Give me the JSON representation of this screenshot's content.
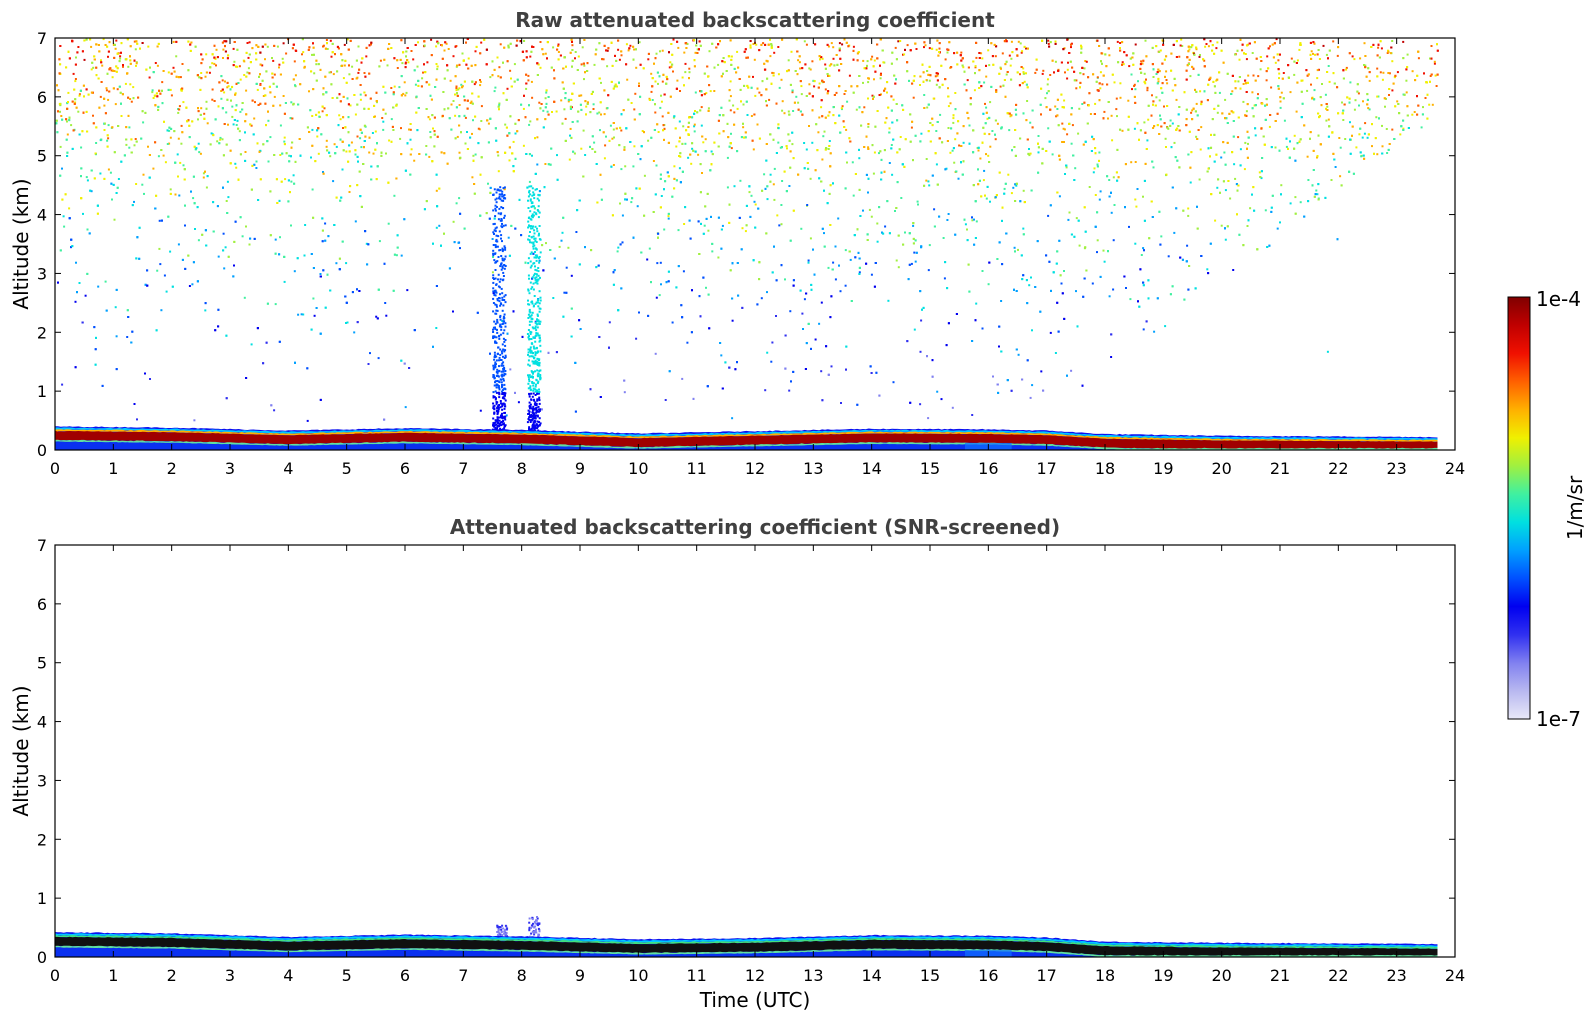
{
  "chart_data": [
    {
      "type": "heatmap",
      "title": "Raw attenuated backscattering coefficient",
      "xlabel": "",
      "ylabel": "Altitude (km)",
      "xlim": [
        0,
        24
      ],
      "ylim": [
        0,
        7
      ],
      "xticks": [
        "0",
        "1",
        "2",
        "3",
        "4",
        "5",
        "6",
        "7",
        "8",
        "9",
        "10",
        "11",
        "12",
        "13",
        "14",
        "15",
        "16",
        "17",
        "18",
        "19",
        "20",
        "21",
        "22",
        "23",
        "24"
      ],
      "yticks": [
        "0",
        "1",
        "2",
        "3",
        "4",
        "5",
        "6",
        "7"
      ],
      "grid": false,
      "data_end_time": 23.7,
      "layer_top_km": [
        {
          "t": 0,
          "km": 0.4
        },
        {
          "t": 2,
          "km": 0.38
        },
        {
          "t": 4,
          "km": 0.33
        },
        {
          "t": 6,
          "km": 0.37
        },
        {
          "t": 8,
          "km": 0.34
        },
        {
          "t": 10,
          "km": 0.28
        },
        {
          "t": 12,
          "km": 0.32
        },
        {
          "t": 14,
          "km": 0.36
        },
        {
          "t": 16,
          "km": 0.35
        },
        {
          "t": 17,
          "km": 0.33
        },
        {
          "t": 18,
          "km": 0.27
        },
        {
          "t": 20,
          "km": 0.24
        },
        {
          "t": 22,
          "km": 0.23
        },
        {
          "t": 23.7,
          "km": 0.22
        }
      ],
      "high_signal_noise_top": "above ~5 km across the day, extending down toward the surface before ~17 UTC",
      "vertical_features_time": [
        7.6,
        8.2
      ]
    },
    {
      "type": "heatmap",
      "title": "Attenuated backscattering coefficient (SNR-screened)",
      "xlabel": "Time (UTC)",
      "ylabel": "Altitude (km)",
      "xlim": [
        0,
        24
      ],
      "ylim": [
        0,
        7
      ],
      "xticks": [
        "0",
        "1",
        "2",
        "3",
        "4",
        "5",
        "6",
        "7",
        "8",
        "9",
        "10",
        "11",
        "12",
        "13",
        "14",
        "15",
        "16",
        "17",
        "18",
        "19",
        "20",
        "21",
        "22",
        "23",
        "24"
      ],
      "yticks": [
        "0",
        "1",
        "2",
        "3",
        "4",
        "5",
        "6",
        "7"
      ],
      "grid": false,
      "data_end_time": 23.7,
      "layer_top_km": [
        {
          "t": 0,
          "km": 0.42
        },
        {
          "t": 2,
          "km": 0.4
        },
        {
          "t": 4,
          "km": 0.34
        },
        {
          "t": 6,
          "km": 0.38
        },
        {
          "t": 8,
          "km": 0.35
        },
        {
          "t": 10,
          "km": 0.3
        },
        {
          "t": 12,
          "km": 0.32
        },
        {
          "t": 14,
          "km": 0.37
        },
        {
          "t": 16,
          "km": 0.36
        },
        {
          "t": 17,
          "km": 0.33
        },
        {
          "t": 18,
          "km": 0.26
        },
        {
          "t": 20,
          "km": 0.24
        },
        {
          "t": 22,
          "km": 0.23
        },
        {
          "t": 23.7,
          "km": 0.22
        }
      ]
    }
  ],
  "colorbar": {
    "label": "1/m/sr",
    "max_label": "1e-4",
    "min_label": "1e-7",
    "scale": "log",
    "colors": [
      "#e8e8f8",
      "#b8b8f0",
      "#8080f0",
      "#3030f0",
      "#0000f0",
      "#0050ff",
      "#00a0ff",
      "#00e0e0",
      "#40f0a0",
      "#a0f040",
      "#f0f000",
      "#ffb000",
      "#ff6000",
      "#f01000",
      "#c00000",
      "#800000"
    ]
  }
}
